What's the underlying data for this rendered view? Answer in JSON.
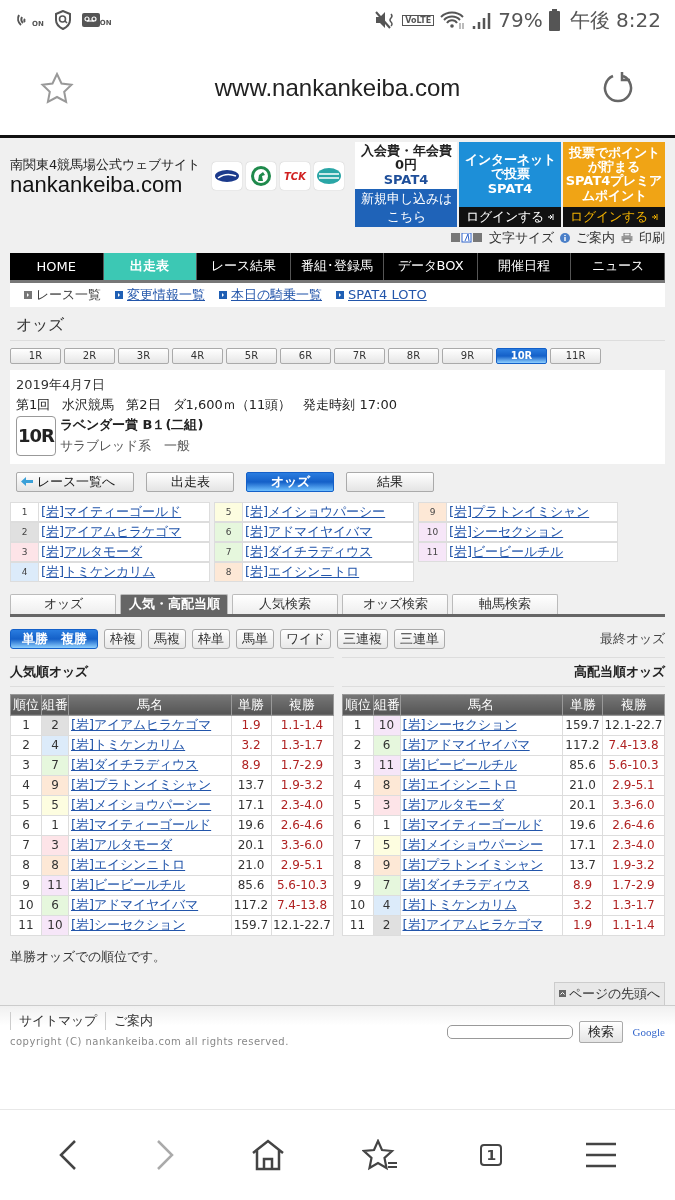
{
  "status_bar": {
    "left_badges": [
      "ON",
      "ON"
    ],
    "network": "VoLTE",
    "battery": "79%",
    "time": "午後 8:22"
  },
  "browser": {
    "url": "www.nankankeiba.com"
  },
  "site": {
    "tagline": "南関東4競馬場公式ウェブサイト",
    "logo": "nankankeiba.com",
    "partner_logo_text": "TCK",
    "banners": [
      {
        "kind": "signup",
        "top": "入会費・年会費0円",
        "brand": "SPAT4",
        "action": "新規申し込みはこちら"
      },
      {
        "kind": "login",
        "top": "インターネットで投票",
        "brand": "SPAT4",
        "action": "ログインする"
      },
      {
        "kind": "premium",
        "top": "投票でポイントが貯まる",
        "brand": "SPAT4プレミアムポイント",
        "action": "ログインする"
      }
    ],
    "utility": {
      "font_size": "文字サイズ",
      "guide": "ご案内",
      "print": "印刷"
    }
  },
  "nav": [
    {
      "label": "HOME",
      "selected": false
    },
    {
      "label": "出走表",
      "selected": true
    },
    {
      "label": "レース結果",
      "selected": false
    },
    {
      "label": "番組･登録馬",
      "selected": false
    },
    {
      "label": "データBOX",
      "selected": false
    },
    {
      "label": "開催日程",
      "selected": false
    },
    {
      "label": "ニュース",
      "selected": false
    }
  ],
  "subnav": [
    {
      "label": "レース一覧",
      "current": true
    },
    {
      "label": "変更情報一覧",
      "current": false
    },
    {
      "label": "本日の騎乗一覧",
      "current": false
    },
    {
      "label": "SPAT4 LOTO",
      "current": false
    }
  ],
  "page_title": "オッズ",
  "race_tabs": [
    {
      "label": "1R",
      "selected": false
    },
    {
      "label": "2R",
      "selected": false
    },
    {
      "label": "3R",
      "selected": false
    },
    {
      "label": "4R",
      "selected": false
    },
    {
      "label": "5R",
      "selected": false
    },
    {
      "label": "6R",
      "selected": false
    },
    {
      "label": "7R",
      "selected": false
    },
    {
      "label": "8R",
      "selected": false
    },
    {
      "label": "9R",
      "selected": false
    },
    {
      "label": "10R",
      "selected": true
    },
    {
      "label": "11R",
      "selected": false
    }
  ],
  "race": {
    "date": "2019年4月7日",
    "meeting": "第1回",
    "venue": "水沢競馬",
    "day": "第2日",
    "course": "ダ1,600ｍ（11頭）",
    "start_time": "発走時刻 17:00",
    "number": "10R",
    "name": "ラベンダー賞 B１(二組)",
    "category": "サラブレッド系　一般"
  },
  "race_buttons": [
    {
      "kind": "back",
      "label": "レース一覧へ",
      "selected": false
    },
    {
      "kind": "plain",
      "label": "出走表",
      "selected": false
    },
    {
      "kind": "plain",
      "label": "オッズ",
      "selected": true
    },
    {
      "kind": "plain",
      "label": "結果",
      "selected": false
    }
  ],
  "horses": [
    {
      "number": "1",
      "name": "[岩]マイティーゴールド",
      "color": "#ffffff"
    },
    {
      "number": "2",
      "name": "[岩]アイアムヒラケゴマ",
      "color": "#e0e0e0"
    },
    {
      "number": "3",
      "name": "[岩]アルタモーダ",
      "color": "#fde4e8"
    },
    {
      "number": "4",
      "name": "[岩]トミケンカリム",
      "color": "#dcebfa"
    },
    {
      "number": "5",
      "name": "[岩]メイショウパーシー",
      "color": "#fdfde0"
    },
    {
      "number": "6",
      "name": "[岩]アドマイヤイバマ",
      "color": "#e6f7dd"
    },
    {
      "number": "7",
      "name": "[岩]ダイチラディウス",
      "color": "#e6f7dd"
    },
    {
      "number": "8",
      "name": "[岩]エイシンニトロ",
      "color": "#fde8d6"
    },
    {
      "number": "9",
      "name": "[岩]プラトンイミシャン",
      "color": "#fde8d6"
    },
    {
      "number": "10",
      "name": "[岩]シーセクション",
      "color": "#f6e6f8"
    },
    {
      "number": "11",
      "name": "[岩]ビービールチル",
      "color": "#f6e6f8"
    }
  ],
  "odds_tabs": [
    {
      "label": "オッズ",
      "selected": false
    },
    {
      "label": "人気・高配当順",
      "selected": true
    },
    {
      "label": "人気検索",
      "selected": false
    },
    {
      "label": "オッズ検索",
      "selected": false
    },
    {
      "label": "軸馬検索",
      "selected": false
    }
  ],
  "bet_types": [
    {
      "label": "単勝　複勝",
      "selected": true
    },
    {
      "label": "枠複",
      "selected": false
    },
    {
      "label": "馬複",
      "selected": false
    },
    {
      "label": "枠単",
      "selected": false
    },
    {
      "label": "馬単",
      "selected": false
    },
    {
      "label": "ワイド",
      "selected": false
    },
    {
      "label": "三連複",
      "selected": false
    },
    {
      "label": "三連単",
      "selected": false
    }
  ],
  "odds_status": "最終オッズ",
  "tables": [
    {
      "title": "人気順オッズ",
      "columns": [
        "順位",
        "組番",
        "馬名",
        "単勝",
        "複勝"
      ],
      "rows": [
        {
          "rank": "1",
          "number": "2",
          "color": "#e0e0e0",
          "name": "[岩]アイアムヒラケゴマ",
          "win": "1.9",
          "place": "1.1-1.4",
          "win_highlighted": true,
          "place_highlighted": true
        },
        {
          "rank": "2",
          "number": "4",
          "color": "#dcebfa",
          "name": "[岩]トミケンカリム",
          "win": "3.2",
          "place": "1.3-1.7",
          "win_highlighted": true,
          "place_highlighted": true
        },
        {
          "rank": "3",
          "number": "7",
          "color": "#e6f7dd",
          "name": "[岩]ダイチラディウス",
          "win": "8.9",
          "place": "1.7-2.9",
          "win_highlighted": true,
          "place_highlighted": true
        },
        {
          "rank": "4",
          "number": "9",
          "color": "#fde8d6",
          "name": "[岩]プラトンイミシャン",
          "win": "13.7",
          "place": "1.9-3.2",
          "win_highlighted": false,
          "place_highlighted": true
        },
        {
          "rank": "5",
          "number": "5",
          "color": "#fdfde0",
          "name": "[岩]メイショウパーシー",
          "win": "17.1",
          "place": "2.3-4.0",
          "win_highlighted": false,
          "place_highlighted": true
        },
        {
          "rank": "6",
          "number": "1",
          "color": "#ffffff",
          "name": "[岩]マイティーゴールド",
          "win": "19.6",
          "place": "2.6-4.6",
          "win_highlighted": false,
          "place_highlighted": true
        },
        {
          "rank": "7",
          "number": "3",
          "color": "#fde4e8",
          "name": "[岩]アルタモーダ",
          "win": "20.1",
          "place": "3.3-6.0",
          "win_highlighted": false,
          "place_highlighted": true
        },
        {
          "rank": "8",
          "number": "8",
          "color": "#fde8d6",
          "name": "[岩]エイシンニトロ",
          "win": "21.0",
          "place": "2.9-5.1",
          "win_highlighted": false,
          "place_highlighted": true
        },
        {
          "rank": "9",
          "number": "11",
          "color": "#f6e6f8",
          "name": "[岩]ビービールチル",
          "win": "85.6",
          "place": "5.6-10.3",
          "win_highlighted": false,
          "place_highlighted": true
        },
        {
          "rank": "10",
          "number": "6",
          "color": "#e6f7dd",
          "name": "[岩]アドマイヤイバマ",
          "win": "117.2",
          "place": "7.4-13.8",
          "win_highlighted": false,
          "place_highlighted": true
        },
        {
          "rank": "11",
          "number": "10",
          "color": "#f6e6f8",
          "name": "[岩]シーセクション",
          "win": "159.7",
          "place": "12.1-22.7",
          "win_highlighted": false,
          "place_highlighted": false
        }
      ]
    },
    {
      "title": "高配当順オッズ",
      "columns": [
        "順位",
        "組番",
        "馬名",
        "単勝",
        "複勝"
      ],
      "rows": [
        {
          "rank": "1",
          "number": "10",
          "color": "#f6e6f8",
          "name": "[岩]シーセクション",
          "win": "159.7",
          "place": "12.1-22.7",
          "win_highlighted": false,
          "place_highlighted": false
        },
        {
          "rank": "2",
          "number": "6",
          "color": "#e6f7dd",
          "name": "[岩]アドマイヤイバマ",
          "win": "117.2",
          "place": "7.4-13.8",
          "win_highlighted": false,
          "place_highlighted": true
        },
        {
          "rank": "3",
          "number": "11",
          "color": "#f6e6f8",
          "name": "[岩]ビービールチル",
          "win": "85.6",
          "place": "5.6-10.3",
          "win_highlighted": false,
          "place_highlighted": true
        },
        {
          "rank": "4",
          "number": "8",
          "color": "#fde8d6",
          "name": "[岩]エイシンニトロ",
          "win": "21.0",
          "place": "2.9-5.1",
          "win_highlighted": false,
          "place_highlighted": true
        },
        {
          "rank": "5",
          "number": "3",
          "color": "#fde4e8",
          "name": "[岩]アルタモーダ",
          "win": "20.1",
          "place": "3.3-6.0",
          "win_highlighted": false,
          "place_highlighted": true
        },
        {
          "rank": "6",
          "number": "1",
          "color": "#ffffff",
          "name": "[岩]マイティーゴールド",
          "win": "19.6",
          "place": "2.6-4.6",
          "win_highlighted": false,
          "place_highlighted": true
        },
        {
          "rank": "7",
          "number": "5",
          "color": "#fdfde0",
          "name": "[岩]メイショウパーシー",
          "win": "17.1",
          "place": "2.3-4.0",
          "win_highlighted": false,
          "place_highlighted": true
        },
        {
          "rank": "8",
          "number": "9",
          "color": "#fde8d6",
          "name": "[岩]プラトンイミシャン",
          "win": "13.7",
          "place": "1.9-3.2",
          "win_highlighted": false,
          "place_highlighted": true
        },
        {
          "rank": "9",
          "number": "7",
          "color": "#e6f7dd",
          "name": "[岩]ダイチラディウス",
          "win": "8.9",
          "place": "1.7-2.9",
          "win_highlighted": true,
          "place_highlighted": true
        },
        {
          "rank": "10",
          "number": "4",
          "color": "#dcebfa",
          "name": "[岩]トミケンカリム",
          "win": "3.2",
          "place": "1.3-1.7",
          "win_highlighted": true,
          "place_highlighted": true
        },
        {
          "rank": "11",
          "number": "2",
          "color": "#e0e0e0",
          "name": "[岩]アイアムヒラケゴマ",
          "win": "1.9",
          "place": "1.1-1.4",
          "win_highlighted": true,
          "place_highlighted": true
        }
      ]
    }
  ],
  "note": "単勝オッズでの順位です。",
  "page_top": "ページの先頭へ",
  "footer": {
    "links": [
      "サイトマップ",
      "ご案内"
    ],
    "copyright": "copyright (C) nankankeiba.com all rights reserved.",
    "search_button": "検索",
    "search_brand": "Google"
  },
  "bottom_nav": {
    "tab_count": "1"
  }
}
